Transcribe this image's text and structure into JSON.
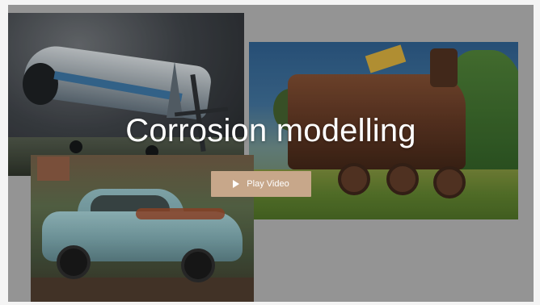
{
  "hero": {
    "title": "Corrosion modelling",
    "play_button_label": "Play Video",
    "play_icon": "play-icon"
  },
  "images": [
    {
      "name": "rusty-airplane-photo"
    },
    {
      "name": "rusty-locomotive-photo"
    },
    {
      "name": "rusty-car-photo"
    }
  ],
  "colors": {
    "button_background": "#c7a78a",
    "backdrop": "#a9a9a9",
    "title_text": "#ffffff"
  }
}
